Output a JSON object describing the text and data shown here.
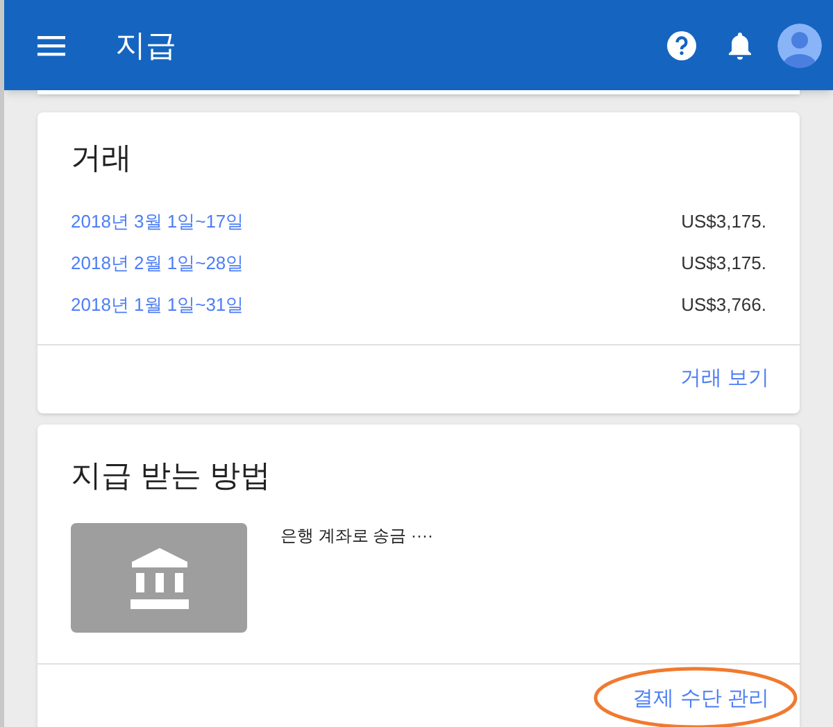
{
  "app_bar": {
    "title": "지급"
  },
  "transactions": {
    "title": "거래",
    "rows": [
      {
        "period": "2018년 3월 1일~17일",
        "amount": "US$3,175."
      },
      {
        "period": "2018년 2월 1일~28일",
        "amount": "US$3,175."
      },
      {
        "period": "2018년 1월 1일~31일",
        "amount": "US$3,766."
      }
    ],
    "action": "거래 보기"
  },
  "payment_method": {
    "title": "지급 받는 방법",
    "description": "은행 계좌로 송금 ····",
    "action": "결제 수단 관리",
    "highlighted": true
  }
}
